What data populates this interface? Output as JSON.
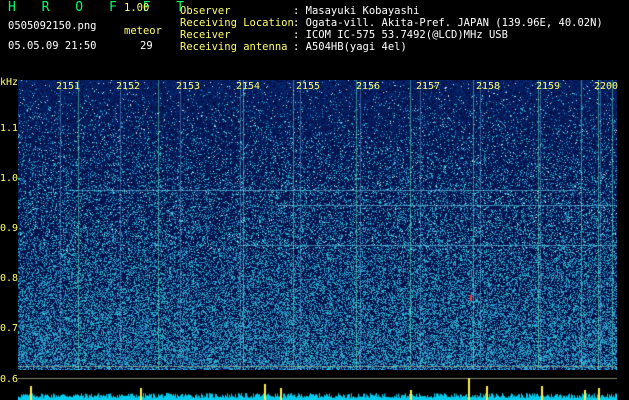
{
  "app": {
    "logo": "H R O F F T",
    "version": "1.00",
    "filename": "0505092150.png",
    "meteor_label": "meteor",
    "timestamp": "05.05.09 21:50",
    "meteor_count": "29"
  },
  "info": [
    {
      "label": "Observer",
      "value": ": Masayuki Kobayashi"
    },
    {
      "label": "Receiving Location",
      "value": ": Ogata-vill. Akita-Pref. JAPAN (139.96E, 40.02N)"
    },
    {
      "label": "Receiver",
      "value": ": ICOM IC-575 53.7492(@LCD)MHz USB"
    },
    {
      "label": "Receiving antenna",
      "value": ": A504HB(yagi 4el)"
    }
  ],
  "axis": {
    "unit": "kHz",
    "y_ticks": [
      "1.1",
      "1.0",
      "0.9",
      "0.8",
      "0.7",
      "0.6"
    ],
    "x_ticks": [
      "2151",
      "2152",
      "2153",
      "2154",
      "2155",
      "2156",
      "2157",
      "2158",
      "2159",
      "2200"
    ]
  },
  "colors": {
    "background": "#000000",
    "label_yellow": "#ffff66",
    "logo_green": "#00ff66",
    "spectrum_blue": "#0a1a6a"
  }
}
